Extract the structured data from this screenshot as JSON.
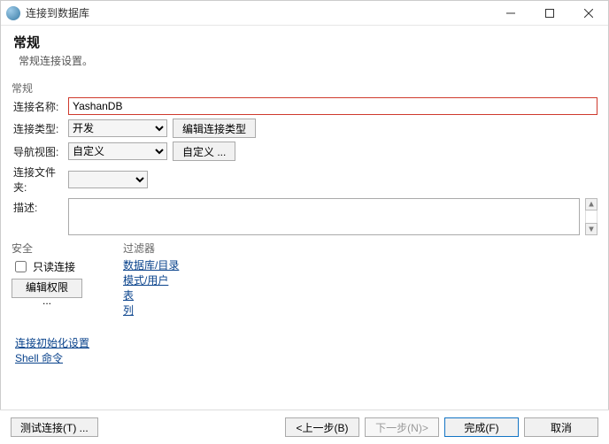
{
  "window": {
    "title": "连接到数据库"
  },
  "header": {
    "title": "常规",
    "subtitle": "常规连接设置。"
  },
  "section": {
    "title": "常规"
  },
  "fields": {
    "name_label": "连接名称:",
    "name_value": "YashanDB",
    "type_label": "连接类型:",
    "type_value": "开发",
    "edit_type_btn": "编辑连接类型",
    "nav_label": "导航视图:",
    "nav_value": "自定义",
    "nav_custom_btn": "自定义 ...",
    "folder_label": "连接文件夹:",
    "folder_value": "",
    "desc_label": "描述:",
    "desc_value": ""
  },
  "security": {
    "title": "安全",
    "readonly_label": "只读连接",
    "readonly_checked": false,
    "edit_perm_btn": "编辑权限 ..."
  },
  "filters": {
    "title": "过滤器",
    "items": [
      "数据库/目录",
      "模式/用户",
      "表",
      "列"
    ]
  },
  "links": {
    "init": "连接初始化设置",
    "shell": "Shell 命令"
  },
  "footer": {
    "test": "测试连接(T) ...",
    "prev": "<上一步(B)",
    "next": "下一步(N)>",
    "finish": "完成(F)",
    "cancel": "取消"
  }
}
